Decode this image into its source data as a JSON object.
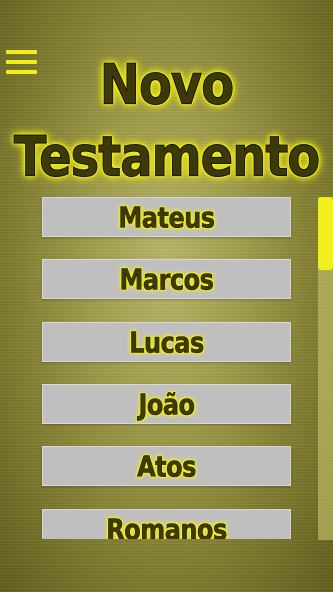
{
  "header": {
    "menu_icon": "hamburger-menu-icon",
    "title_line1": "Novo",
    "title_line2": "Testamento"
  },
  "books": [
    {
      "label": "Mateus"
    },
    {
      "label": "Marcos"
    },
    {
      "label": "Lucas"
    },
    {
      "label": "João"
    },
    {
      "label": "Atos"
    },
    {
      "label": "Romanos"
    }
  ],
  "colors": {
    "accent_yellow": "#f3ee1a",
    "text_dark": "#3b3a08",
    "button_gray": "#c0bfbf",
    "background_olive": "#9e9a48"
  }
}
